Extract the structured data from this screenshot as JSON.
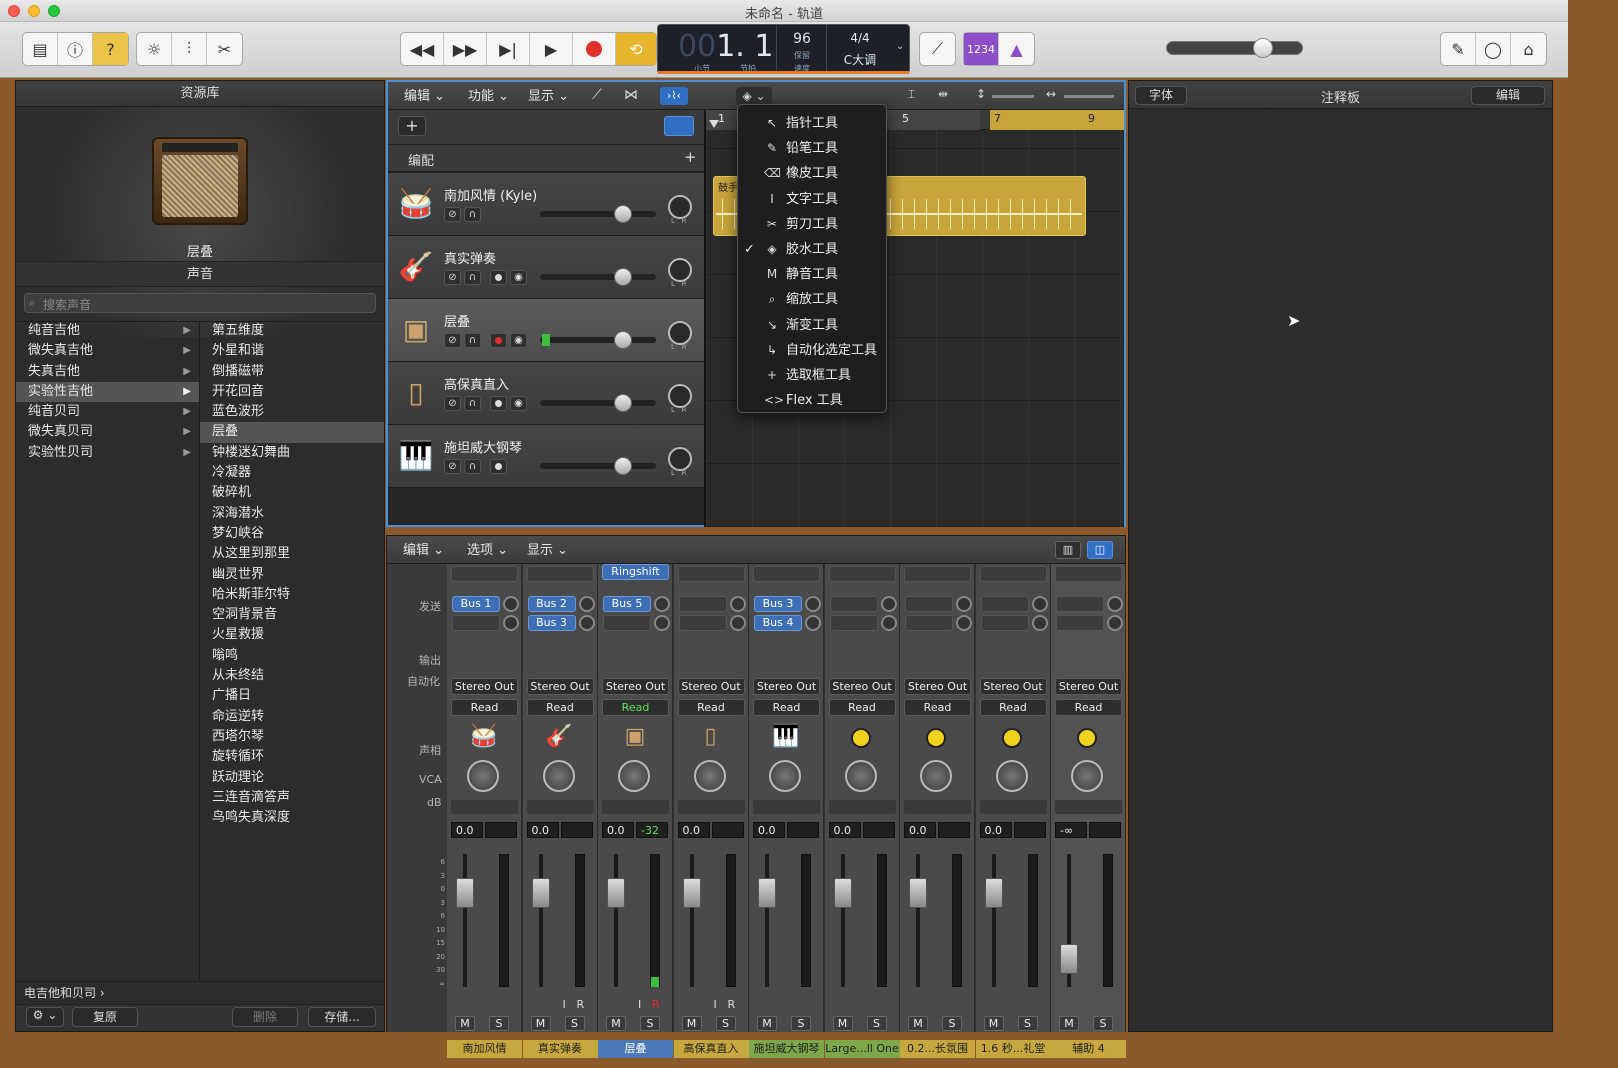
{
  "window": {
    "title": "未命名 - 轨道"
  },
  "lcd": {
    "bar_faint": "00",
    "position": "1. 1",
    "bar_label": "小节",
    "beat_label": "节拍",
    "tempo": "96",
    "tempo_sub": "保留",
    "tempo_label": "速度",
    "time_sig": "4/4",
    "key": "C大调"
  },
  "toolbar": {
    "count_in": "1234"
  },
  "library": {
    "title": "资源库",
    "patch_name": "层叠",
    "sound_header": "声音",
    "search_placeholder": "搜索声音",
    "categories": [
      "纯音吉他",
      "微失真吉他",
      "失真吉他",
      "实验性吉他",
      "纯音贝司",
      "微失真贝司",
      "实验性贝司"
    ],
    "patches": [
      "第五维度",
      "外星和谐",
      "倒播磁带",
      "开花回音",
      "蓝色波形",
      "层叠",
      "钟楼迷幻舞曲",
      "冷凝器",
      "破碎机",
      "深海潜水",
      "梦幻峡谷",
      "从这里到那里",
      "幽灵世界",
      "哈米斯菲尔特",
      "空洞背景音",
      "火星救援",
      "嗡鸣",
      "从未终结",
      "广播日",
      "命运逆转",
      "西塔尔琴",
      "旋转循环",
      "跃动理论",
      "三连音滴答声",
      "鸟鸣失真深度"
    ],
    "footer_path": "电吉他和贝司",
    "revert": "复原",
    "delete": "删除",
    "save": "存储..."
  },
  "tracks": {
    "menus": [
      "编辑",
      "功能",
      "显示"
    ],
    "arrangement_label": "编配",
    "list": [
      {
        "name": "南加风情 (Kyle)"
      },
      {
        "name": "真实弹奏"
      },
      {
        "name": "层叠"
      },
      {
        "name": "高保真直入"
      },
      {
        "name": "施坦威大钢琴"
      }
    ],
    "ruler": [
      "1",
      "5",
      "7",
      "9"
    ],
    "region_label": "鼓手"
  },
  "tool_menu": {
    "items": [
      "指针工具",
      "铅笔工具",
      "橡皮工具",
      "文字工具",
      "剪刀工具",
      "胶水工具",
      "静音工具",
      "缩放工具",
      "渐变工具",
      "自动化选定工具",
      "选取框工具",
      "Flex 工具"
    ],
    "checked": "胶水工具"
  },
  "mixer": {
    "menus": [
      "编辑",
      "选项",
      "显示"
    ],
    "row_labels": {
      "sends": "发送",
      "output": "输出",
      "automation": "自动化",
      "pan": "声相",
      "vca": "VCA",
      "db": "dB"
    },
    "insert_ringshift": "Ringshift",
    "strips": [
      {
        "name": "南加风情",
        "sends": [
          "Bus 1"
        ],
        "output": "Stereo Out",
        "auto": "Read",
        "db": "0.0",
        "peak": ""
      },
      {
        "name": "真实弹奏",
        "sends": [
          "Bus 2",
          "Bus 3"
        ],
        "output": "Stereo Out",
        "auto": "Read",
        "db": "0.0",
        "peak": ""
      },
      {
        "name": "层叠",
        "sends": [
          "Bus 5"
        ],
        "output": "Stereo Out",
        "auto": "Read",
        "db": "0.0",
        "peak": "-32"
      },
      {
        "name": "高保真直入",
        "sends": [],
        "output": "Stereo Out",
        "auto": "Read",
        "db": "0.0",
        "peak": ""
      },
      {
        "name": "施坦威大钢琴",
        "sends": [
          "Bus 3",
          "Bus 4"
        ],
        "output": "Stereo Out",
        "auto": "Read",
        "db": "0.0",
        "peak": ""
      },
      {
        "name": "Large...ll One",
        "sends": [],
        "output": "Stereo Out",
        "auto": "Read",
        "db": "0.0",
        "peak": ""
      },
      {
        "name": "0.2...长氛围",
        "sends": [],
        "output": "Stereo Out",
        "auto": "Read",
        "db": "0.0",
        "peak": ""
      },
      {
        "name": "1.6 秒...礼堂",
        "sends": [],
        "output": "Stereo Out",
        "auto": "Read",
        "db": "0.0",
        "peak": ""
      },
      {
        "name": "辅助 4",
        "sends": [],
        "output": "Stereo Out",
        "auto": "Read",
        "db": "-∞",
        "peak": ""
      }
    ],
    "m": "M",
    "s": "S",
    "i": "I",
    "r": "R"
  },
  "notes": {
    "font_btn": "字体",
    "title": "注释板",
    "edit_btn": "编辑"
  },
  "colors": {
    "accent_blue": "#4a90d9",
    "region_yellow": "#c8a53a",
    "record_red": "#e0302a",
    "cycle_yellow": "#e7b52c",
    "purple": "#8c4fc9"
  }
}
